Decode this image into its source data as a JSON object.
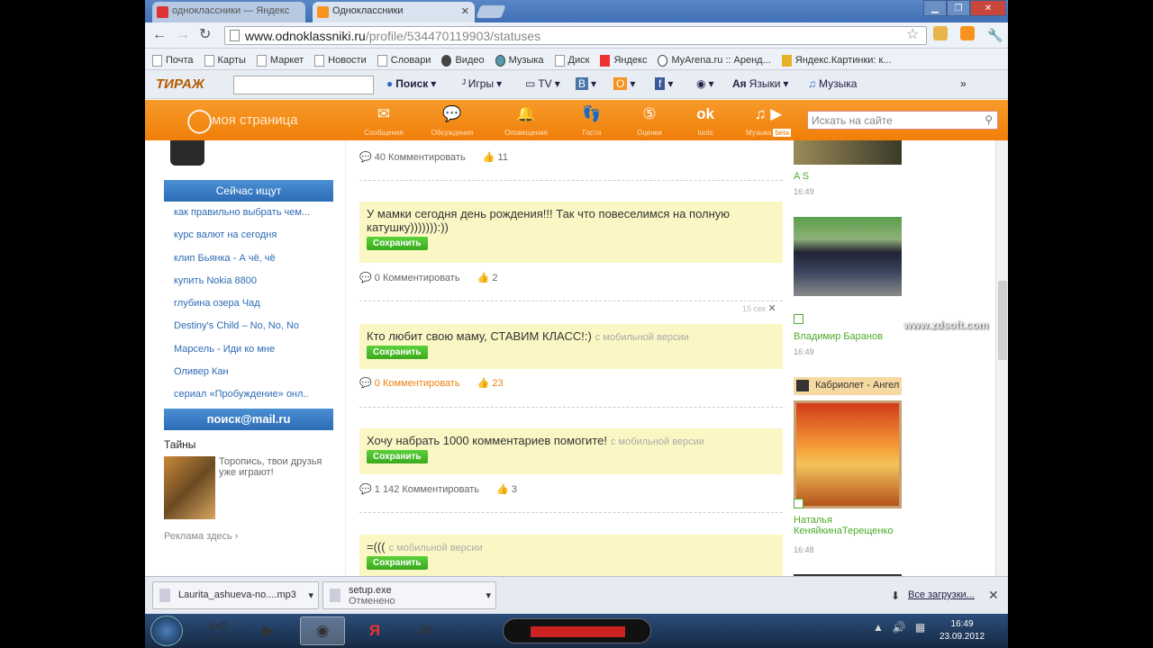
{
  "browser": {
    "tabs": [
      {
        "label": "одноклассники — Яндекс",
        "active": false
      },
      {
        "label": "Одноклассники",
        "active": true
      }
    ],
    "url_host": "www.odnoklassniki.ru",
    "url_path": "/profile/534470119903/statuses"
  },
  "bookmarks": [
    "Почта",
    "Карты",
    "Маркет",
    "Новости",
    "Словари",
    "Видео",
    "Музыка",
    "Диск",
    "Яндекс",
    "MyArena.ru :: Аренд...",
    "Яндекс.Картинки: к..."
  ],
  "toolbar": {
    "logo": "ТИРАЖ",
    "search": "Поиск",
    "games": "Игры",
    "tv": "TV",
    "languages": "Языки",
    "music": "Музыка"
  },
  "ok": {
    "brand": "моя страница",
    "nav": [
      "Сообщения",
      "Обсуждения",
      "Оповещения",
      "Гости",
      "Оценки",
      "tools",
      "Музыка"
    ],
    "music_badge": "beta",
    "search_placeholder": "Искать на сайте"
  },
  "left": {
    "search_header": "Сейчас ищут",
    "queries": [
      "как правильно выбрать чем...",
      "курс валют на сегодня",
      "клип Бьянка - А чё, чё",
      "купить Nokia 8800",
      "глубина озера Чад",
      "Destiny's Child – No, No, No",
      "Марсель - Иди ко мне",
      "Оливер Кан",
      "сериал «Пробуждение» онл.."
    ],
    "mail_banner": "поиск@mail.ru",
    "game_title": "Тайны",
    "game_text": "Торопись, твои друзья уже играют!",
    "ads": "Реклама здесь ›"
  },
  "statuses": [
    {
      "text": "",
      "mobile": "",
      "comments": "40 Комментировать",
      "likes": "11"
    },
    {
      "text": "У мамки сегодня день рождения!!! Так что повеселимся на полную катушку))))))):))",
      "mobile": "",
      "save": "Сохранить",
      "comments": "0 Комментировать",
      "likes": "2"
    },
    {
      "text": "Кто любит свою маму, СТАВИМ КЛАСС!:)",
      "mobile": "с мобильной версии",
      "save": "Сохранить",
      "comments": "0 Комментировать",
      "likes": "23"
    },
    {
      "text": "Хочу набрать 1000 комментариев помогите!",
      "mobile": "с мобильной версии",
      "save": "Сохранить",
      "comments": "1 142 Комментировать",
      "likes": "3"
    },
    {
      "text": "=(((",
      "mobile": "с мобильной версии",
      "save": "Сохранить"
    }
  ],
  "tiny_time": "15 сек",
  "right": {
    "items": [
      {
        "name": "A S",
        "time": "16:49"
      },
      {
        "name": "Владимир Баранов",
        "time": "16:49"
      },
      {
        "name": "Наталья КеняйкинаТерещенко",
        "time": "16:48"
      }
    ],
    "song": "Кабриолет - Ангел",
    "watermark": "www.zdsoft.com"
  },
  "downloads": {
    "items": [
      {
        "name": "Laurita_ashueva-no....mp3",
        "status": ""
      },
      {
        "name": "setup.exe",
        "status": "Отменено"
      }
    ],
    "all": "Все загрузки..."
  },
  "taskbar": {
    "time": "16:49",
    "date": "23.09.2012"
  }
}
